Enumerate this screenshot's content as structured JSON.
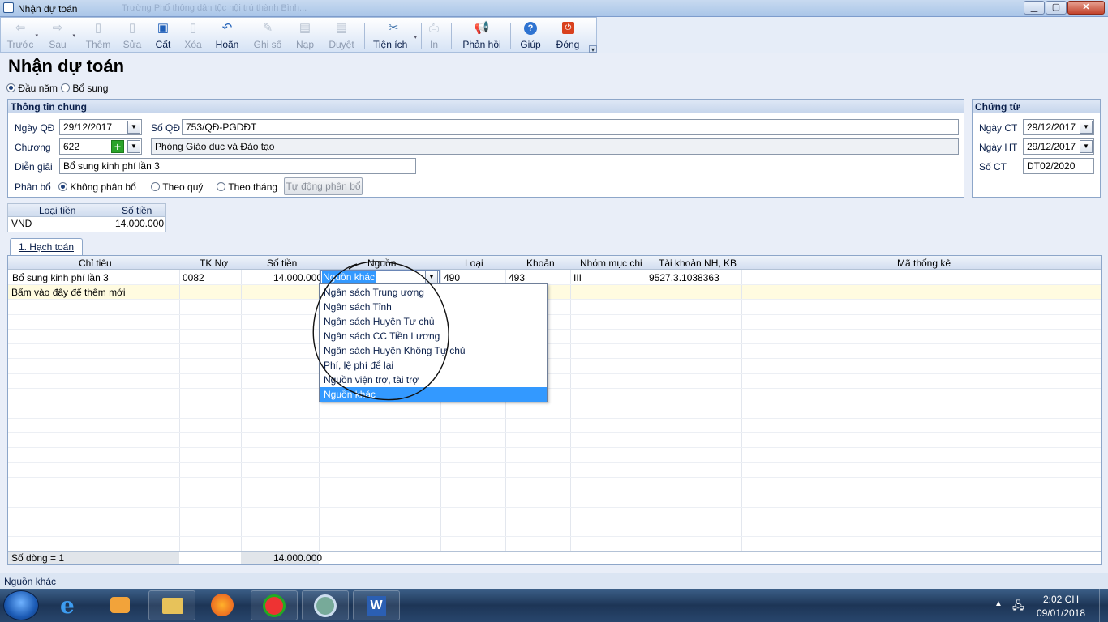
{
  "window": {
    "title": "Nhận dự toán",
    "ghost_title": "Trường Phổ thông dân tộc nội trú thành Bình..."
  },
  "toolbar": {
    "truoc": "Trước",
    "sau": "Sau",
    "them": "Thêm",
    "sua": "Sửa",
    "cat": "Cất",
    "xoa": "Xóa",
    "hoan": "Hoãn",
    "ghiso": "Ghi sổ",
    "nap": "Nạp",
    "duyet": "Duyệt",
    "tienich": "Tiện ích",
    "in": "In",
    "phanhoi": "Phản hồi",
    "giup": "Giúp",
    "dong": "Đóng"
  },
  "page": {
    "title": "Nhận dự toán",
    "radio_daunam": "Đầu năm",
    "radio_bosung": "Bổ sung"
  },
  "general": {
    "header": "Thông tin chung",
    "ngay_qd_label": "Ngày QĐ",
    "ngay_qd": "29/12/2017",
    "so_qd_label": "Số QĐ",
    "so_qd": "753/QĐ-PGDĐT",
    "chuong_label": "Chương",
    "chuong": "622",
    "chuong_name": "Phòng Giáo dục và Đào tạo",
    "dien_giai_label": "Diễn giải",
    "dien_giai": "Bổ sung kinh phí lần 3",
    "phan_bo_label": "Phân bổ",
    "opt_khong": "Không phân bổ",
    "opt_quy": "Theo quý",
    "opt_thang": "Theo tháng",
    "auto_btn": "Tự động phân bổ"
  },
  "voucher": {
    "header": "Chứng từ",
    "ngay_ct_label": "Ngày CT",
    "ngay_ct": "29/12/2017",
    "ngay_ht_label": "Ngày HT",
    "ngay_ht": "29/12/2017",
    "so_ct_label": "Số CT",
    "so_ct": "DT02/2020"
  },
  "currency": {
    "h_loai": "Loại tiền",
    "h_sotien": "Số tiền",
    "loai": "VND",
    "sotien": "14.000.000"
  },
  "tab": {
    "label": "1. Hạch toán"
  },
  "grid": {
    "headers": {
      "chitieu": "Chỉ tiêu",
      "tkno": "TK Nợ",
      "sotien": "Số tiền",
      "nguon": "Nguồn",
      "loai": "Loại",
      "khoan": "Khoản",
      "nhom": "Nhóm mục chi",
      "tknh": "Tài khoản NH, KB",
      "mathongke": "Mã thống kê"
    },
    "row1": {
      "chitieu": "Bổ sung kinh phí lần 3",
      "tkno": "0082",
      "sotien": "14.000.000",
      "nguon": "Nguồn khác",
      "loai": "490",
      "khoan": "493",
      "nhom": "III",
      "tknh": "9527.3.1038363"
    },
    "new_row": "Bấm vào đây để thêm mới",
    "footer_count": "Số dòng = 1",
    "footer_total": "14.000.000"
  },
  "dropdown": {
    "items": [
      "Ngân sách Trung ương",
      "Ngân sách Tỉnh",
      "Ngân sách Huyện Tự chủ",
      "Ngân sách CC Tiền Lương",
      "Ngân sách Huyện Không Tự chủ",
      "Phí, lệ phí để lại",
      "Nguồn viện trợ, tài trợ",
      "Nguồn khác"
    ],
    "selected": "Nguồn khác"
  },
  "status": {
    "text": "Nguồn khác"
  },
  "taskbar": {
    "time": "2:02 CH",
    "date": "09/01/2018"
  },
  "colors": {
    "accent": "#3399ff",
    "panel_border": "#8da6c9",
    "background": "#e9eef8"
  }
}
